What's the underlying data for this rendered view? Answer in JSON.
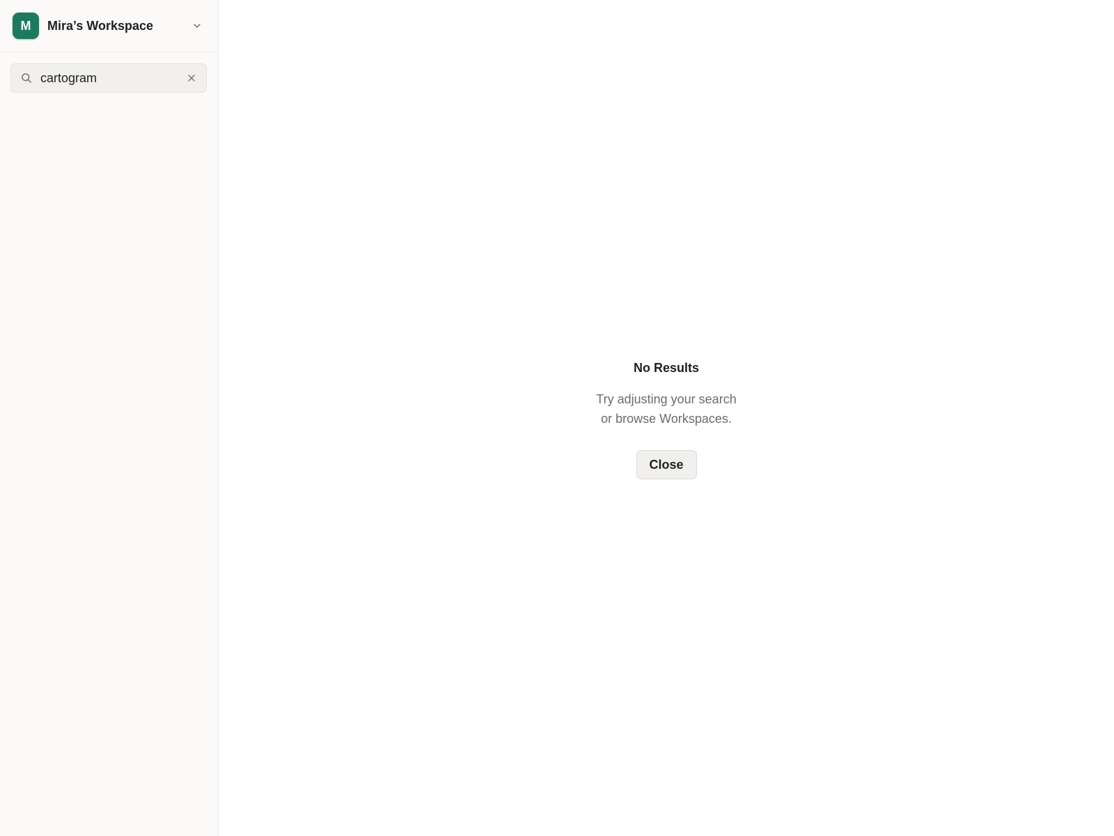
{
  "sidebar": {
    "workspace": {
      "avatar_letter": "M",
      "avatar_color": "#1d7a5f",
      "name": "Mira’s Workspace",
      "dropdown_icon": "chevron-down-icon"
    },
    "search": {
      "icon": "search-icon",
      "value": "cartogram",
      "clear_icon": "close-icon"
    }
  },
  "main": {
    "empty_state": {
      "title": "No Results",
      "message_line1": "Try adjusting your search",
      "message_line2": "or browse Workspaces.",
      "close_label": "Close"
    }
  }
}
